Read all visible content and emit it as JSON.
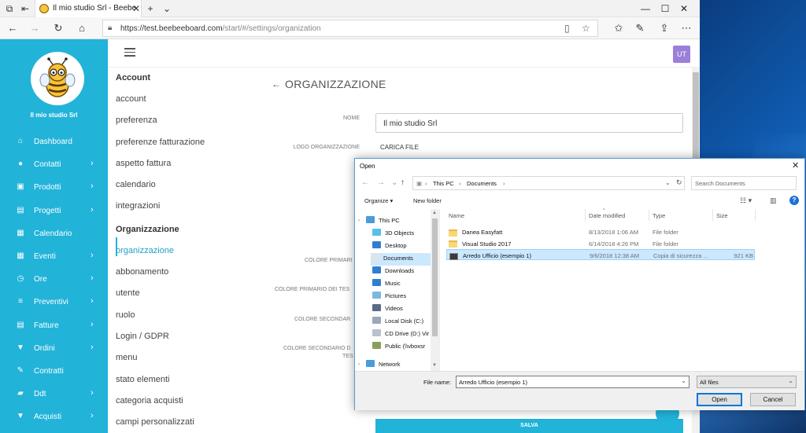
{
  "browser": {
    "tab_title": "Il mio studio Srl - Beebe",
    "url_host": "https://test.beebeeboard.com",
    "url_path": "/start/#/settings/organization"
  },
  "sidebar": {
    "company": "Il mio studio Srl",
    "items": [
      {
        "label": "Dashboard",
        "icon": "home-icon",
        "chevron": false
      },
      {
        "label": "Contatti",
        "icon": "user-icon",
        "chevron": true
      },
      {
        "label": "Prodotti",
        "icon": "basket-icon",
        "chevron": true
      },
      {
        "label": "Progetti",
        "icon": "briefcase-icon",
        "chevron": true
      },
      {
        "label": "Calendario",
        "icon": "calendar-icon",
        "chevron": false
      },
      {
        "label": "Eventi",
        "icon": "calendar-check-icon",
        "chevron": true
      },
      {
        "label": "Ore",
        "icon": "clock-icon",
        "chevron": true
      },
      {
        "label": "Preventivi",
        "icon": "list-icon",
        "chevron": true
      },
      {
        "label": "Fatture",
        "icon": "invoice-icon",
        "chevron": true
      },
      {
        "label": "Ordini",
        "icon": "cart-icon",
        "chevron": true
      },
      {
        "label": "Contratti",
        "icon": "pen-icon",
        "chevron": false
      },
      {
        "label": "Ddt",
        "icon": "truck-icon",
        "chevron": true
      },
      {
        "label": "Acquisti",
        "icon": "cart-icon",
        "chevron": true
      }
    ]
  },
  "header": {
    "avatar": "UT"
  },
  "settings_menu": {
    "account_heading": "Account",
    "account_items": [
      "account",
      "preferenza",
      "preferenze fatturazione",
      "aspetto fattura",
      "calendario",
      "integrazioni"
    ],
    "org_heading": "Organizzazione",
    "org_items": [
      "organizzazione",
      "abbonamento",
      "utente",
      "ruolo",
      "Login / GDPR",
      "menu",
      "stato elementi",
      "categoria acquisti",
      "campi personalizzati"
    ]
  },
  "form": {
    "title": "ORGANIZZAZIONE",
    "nome_label": "NOME",
    "nome_value": "Il mio studio Srl",
    "logo_label": "LOGO ORGANIZZAZIONE",
    "logo_action": "CARICA FILE",
    "colore_primario_label": "COLORE PRIMARI",
    "colore_primario_testo_label": "COLORE PRIMARIO DEI TES",
    "colore_secondario_label": "COLORE SECONDAR",
    "colore_secondario_testo_label": "COLORE SECONDARIO D",
    "colore_secondario_testo_label2": "TES",
    "save": "SALVA"
  },
  "dialog": {
    "title": "Open",
    "breadcrumb": [
      "This PC",
      "Documents"
    ],
    "search_placeholder": "Search Documents",
    "organize": "Organize ▾",
    "new_folder": "New folder",
    "tree": [
      {
        "label": "This PC",
        "icon": "pc-icon",
        "color": "#4a9bd9",
        "expand": true
      },
      {
        "label": "3D Objects",
        "icon": "cube-icon",
        "color": "#56c1e8"
      },
      {
        "label": "Desktop",
        "icon": "desktop-icon",
        "color": "#2f7fd0"
      },
      {
        "label": "Documents",
        "icon": "documents-icon",
        "color": "#dfe3ea",
        "selected": true
      },
      {
        "label": "Downloads",
        "icon": "download-icon",
        "color": "#2f7fd0"
      },
      {
        "label": "Music",
        "icon": "music-icon",
        "color": "#2f7fd0"
      },
      {
        "label": "Pictures",
        "icon": "pictures-icon",
        "color": "#7fb6e0"
      },
      {
        "label": "Videos",
        "icon": "videos-icon",
        "color": "#5a6a86"
      },
      {
        "label": "Local Disk (C:)",
        "icon": "disk-icon",
        "color": "#9aa8b8"
      },
      {
        "label": "CD Drive (D:) Vir",
        "icon": "cd-icon",
        "color": "#b9c2cc"
      },
      {
        "label": "Public (\\\\vboxsr",
        "icon": "network-drive-icon",
        "color": "#8aa05a"
      },
      {
        "label": "Network",
        "icon": "network-icon",
        "color": "#4a9bd9",
        "expand": true
      }
    ],
    "columns": [
      "Name",
      "Date modified",
      "Type",
      "Size"
    ],
    "files": [
      {
        "name": "Danea Easyfatt",
        "date": "8/13/2018 1:06 AM",
        "type": "File folder",
        "size": "",
        "kind": "folder"
      },
      {
        "name": "Visual Studio 2017",
        "date": "6/14/2018 4:26 PM",
        "type": "File folder",
        "size": "",
        "kind": "folder"
      },
      {
        "name": "Arredo Ufficio (esempio 1)",
        "date": "9/6/2018 12:38 AM",
        "type": "Copia di sicurezza ...",
        "size": "921 KB",
        "kind": "file",
        "selected": true
      }
    ],
    "filename_label": "File name:",
    "filename_value": "Arredo Ufficio (esempio 1)",
    "filetype_value": "All files",
    "open_button": "Open",
    "cancel_button": "Cancel"
  }
}
